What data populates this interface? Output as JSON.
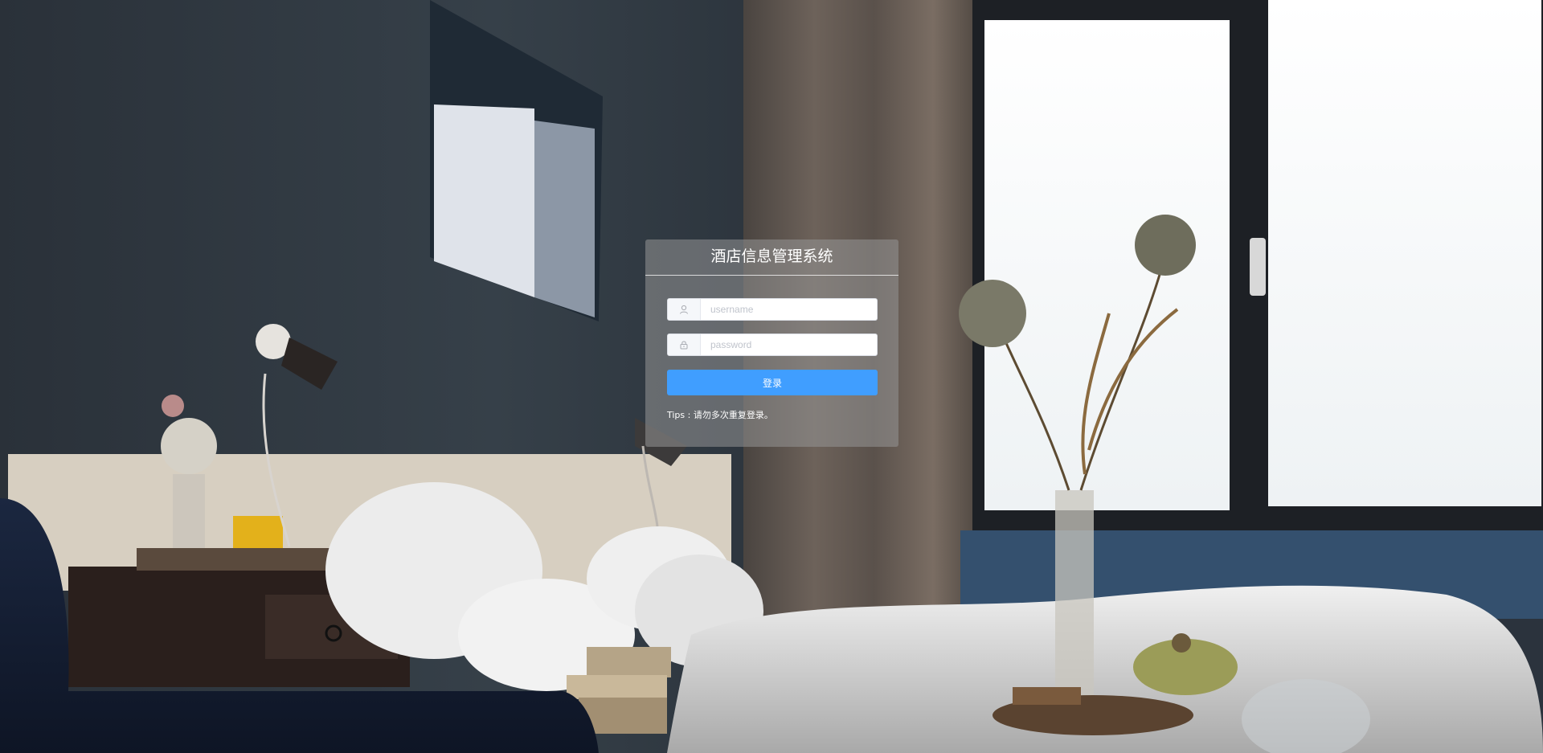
{
  "login": {
    "title": "酒店信息管理系统",
    "username_placeholder": "username",
    "password_placeholder": "password",
    "submit_label": "登录",
    "tips": "Tips : 请勿多次重复登录。"
  },
  "icons": {
    "username": "user-icon",
    "password": "lock-icon"
  },
  "colors": {
    "primary": "#409eff",
    "card_background": "rgba(150,150,150,0.55)"
  }
}
